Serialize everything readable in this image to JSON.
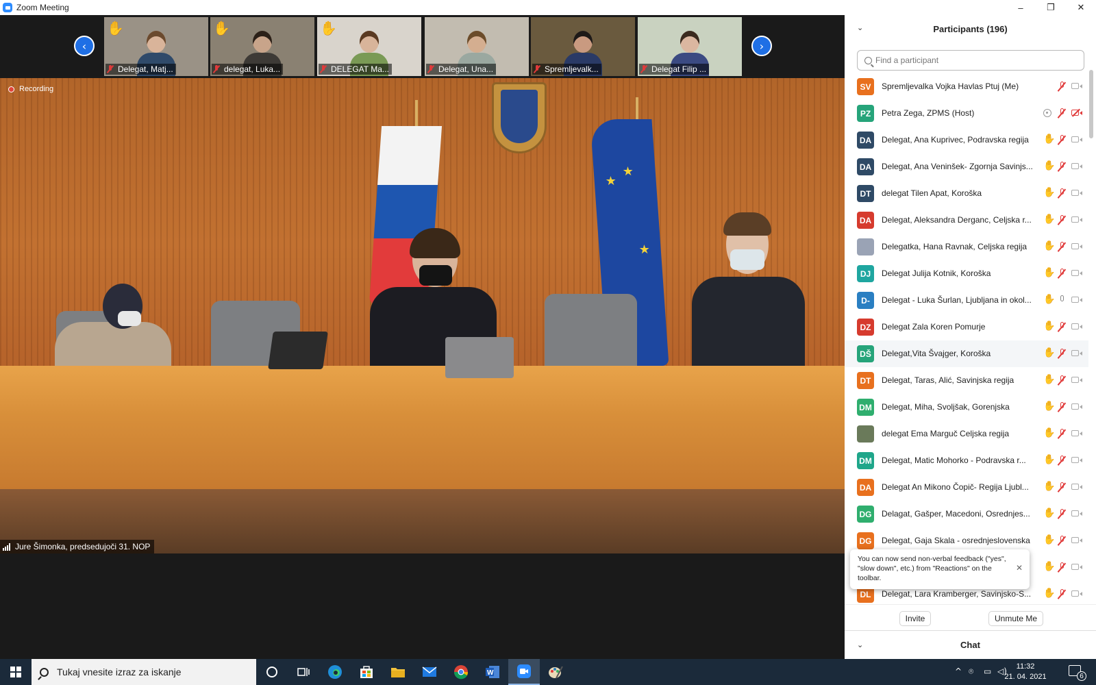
{
  "window": {
    "title": "Zoom Meeting",
    "controls": [
      "–",
      "❐",
      "✕"
    ]
  },
  "gallery": {
    "prev_icon": "‹",
    "next_icon": "›",
    "thumbnails": [
      {
        "name": "Delegat, Matj...",
        "hand": "✋",
        "bg": "#9a9286",
        "skin": "#d9b49a",
        "shirt": "#2f4a6a",
        "hair": "#6b4a2e"
      },
      {
        "name": "delegat, Luka...",
        "hand": "✋",
        "bg": "#8a8172",
        "skin": "#c8a48a",
        "shirt": "#3d3a36",
        "hair": "#2b2018"
      },
      {
        "name": "DELEGAT Ma...",
        "hand": "✋",
        "bg": "#d9d4cc",
        "skin": "#d8b49a",
        "shirt": "#7a9a55",
        "hair": "#5a3a22"
      },
      {
        "name": "Delegat, Una...",
        "hand": "",
        "bg": "#c2bcb0",
        "skin": "#d4ae90",
        "shirt": "#9aa8a0",
        "hair": "#6b4c2a"
      },
      {
        "name": "Spremljevalk...",
        "hand": "",
        "bg": "#6a5a3e",
        "skin": "#c99a80",
        "shirt": "#2a3a66",
        "hair": "#1e1a18"
      },
      {
        "name": "Delegat Filip ...",
        "hand": "",
        "bg": "#c9d2c0",
        "skin": "#dbb7a0",
        "shirt": "#3b4a82",
        "hair": "#3a2a1e"
      }
    ]
  },
  "main_video": {
    "recording_label": "Recording",
    "speaker_name": "Jure Šimonka, predsedujoči 31. NOP"
  },
  "participants": {
    "title": "Participants (196)",
    "collapse_icon": "⌄",
    "search_placeholder": "Find a participant",
    "list": [
      {
        "initials": "SV",
        "color": "#e8701e",
        "name": "Spremljevalka Vojka Havlas Ptuj (Me)",
        "status": "none",
        "mic": "off",
        "cam": "on"
      },
      {
        "initials": "PZ",
        "color": "#26a47a",
        "name": "Petra Zega, ZPMS (Host)",
        "status": "host",
        "mic": "off",
        "cam": "off"
      },
      {
        "initials": "DA",
        "color": "#2f4a66",
        "name": "Delegat, Ana Kuprivec, Podravska regija",
        "status": "hand",
        "mic": "off",
        "cam": "on"
      },
      {
        "initials": "DA",
        "color": "#2f4a66",
        "name": "Delegat, Ana Veninšek- Zgornja Savinjs...",
        "status": "hand",
        "mic": "off",
        "cam": "on"
      },
      {
        "initials": "DT",
        "color": "#2f4a66",
        "name": "delegat Tilen Apat, Koroška",
        "status": "hand",
        "mic": "off",
        "cam": "on"
      },
      {
        "initials": "DA",
        "color": "#d63b2e",
        "name": "Delegat, Aleksandra Derganc, Celjska r...",
        "status": "hand",
        "mic": "off",
        "cam": "on"
      },
      {
        "initials": "",
        "color": "#9aa3b5",
        "name": "Delegatka, Hana Ravnak, Celjska regija",
        "status": "hand-faded",
        "mic": "off",
        "cam": "on"
      },
      {
        "initials": "DJ",
        "color": "#1fa6a0",
        "name": "Delegat Julija Kotnik, Koroška",
        "status": "hand",
        "mic": "off",
        "cam": "on"
      },
      {
        "initials": "D-",
        "color": "#2a7fc2",
        "name": "Delegat - Luka Šurlan, Ljubljana in okol...",
        "status": "hand",
        "mic": "on",
        "cam": "on"
      },
      {
        "initials": "DZ",
        "color": "#d63b2e",
        "name": "Delegat Zala Koren Pomurje",
        "status": "hand",
        "mic": "off",
        "cam": "on"
      },
      {
        "initials": "DŠ",
        "color": "#26a47a",
        "name": "Delegat,Vita Švajger, Koroška",
        "status": "hand",
        "mic": "off",
        "cam": "on"
      },
      {
        "initials": "DT",
        "color": "#e8701e",
        "name": "Delegat, Taras, Alić, Savinjska regija",
        "status": "hand",
        "mic": "off",
        "cam": "on"
      },
      {
        "initials": "DM",
        "color": "#2fae6e",
        "name": "Delegat, Miha, Svoljšak, Gorenjska",
        "status": "hand",
        "mic": "off",
        "cam": "on"
      },
      {
        "initials": "",
        "color": "#6a7a5a",
        "name": "delegat Ema Marguč Celjska regija",
        "status": "hand",
        "mic": "off",
        "cam": "on"
      },
      {
        "initials": "DM",
        "color": "#1fa68a",
        "name": "Delegat, Matic Mohorko - Podravska r...",
        "status": "hand",
        "mic": "off",
        "cam": "on"
      },
      {
        "initials": "DA",
        "color": "#e8701e",
        "name": "Delegat An Mikono Čopič- Regija Ljubl...",
        "status": "hand",
        "mic": "off",
        "cam": "on"
      },
      {
        "initials": "DG",
        "color": "#2fae6e",
        "name": "Delagat, Gašper, Macedoni, Osrednjes...",
        "status": "hand",
        "mic": "off",
        "cam": "on"
      },
      {
        "initials": "DG",
        "color": "#e8701e",
        "name": "Delegat, Gaja Skala - osrednjeslovenska",
        "status": "hand",
        "mic": "off",
        "cam": "on"
      },
      {
        "initials": "",
        "color": "#2f4a66",
        "name": "",
        "status": "hand",
        "mic": "off",
        "cam": "on"
      },
      {
        "initials": "DL",
        "color": "#e8701e",
        "name": "Delegat, Lara Kramberger, Savinjsko-S...",
        "status": "hand",
        "mic": "off",
        "cam": "on"
      }
    ],
    "tooltip": "You can now send non-verbal feedback (\"yes\", \"slow down\", etc.) from \"Reactions\" on the toolbar.",
    "tooltip_close": "✕",
    "invite_label": "Invite",
    "unmute_label": "Unmute Me"
  },
  "chat": {
    "title": "Chat",
    "collapse_icon": "⌄"
  },
  "taskbar": {
    "search_placeholder": "Tukaj vnesite izraz za iskanje",
    "time": "11:32",
    "date": "21. 04. 2021",
    "notification_count": "6",
    "icons": [
      "cortana-icon",
      "task-view-icon",
      "edge-icon",
      "store-icon",
      "file-explorer-icon",
      "mail-icon",
      "chrome-icon",
      "word-icon",
      "zoom-icon",
      "paint-icon"
    ]
  }
}
